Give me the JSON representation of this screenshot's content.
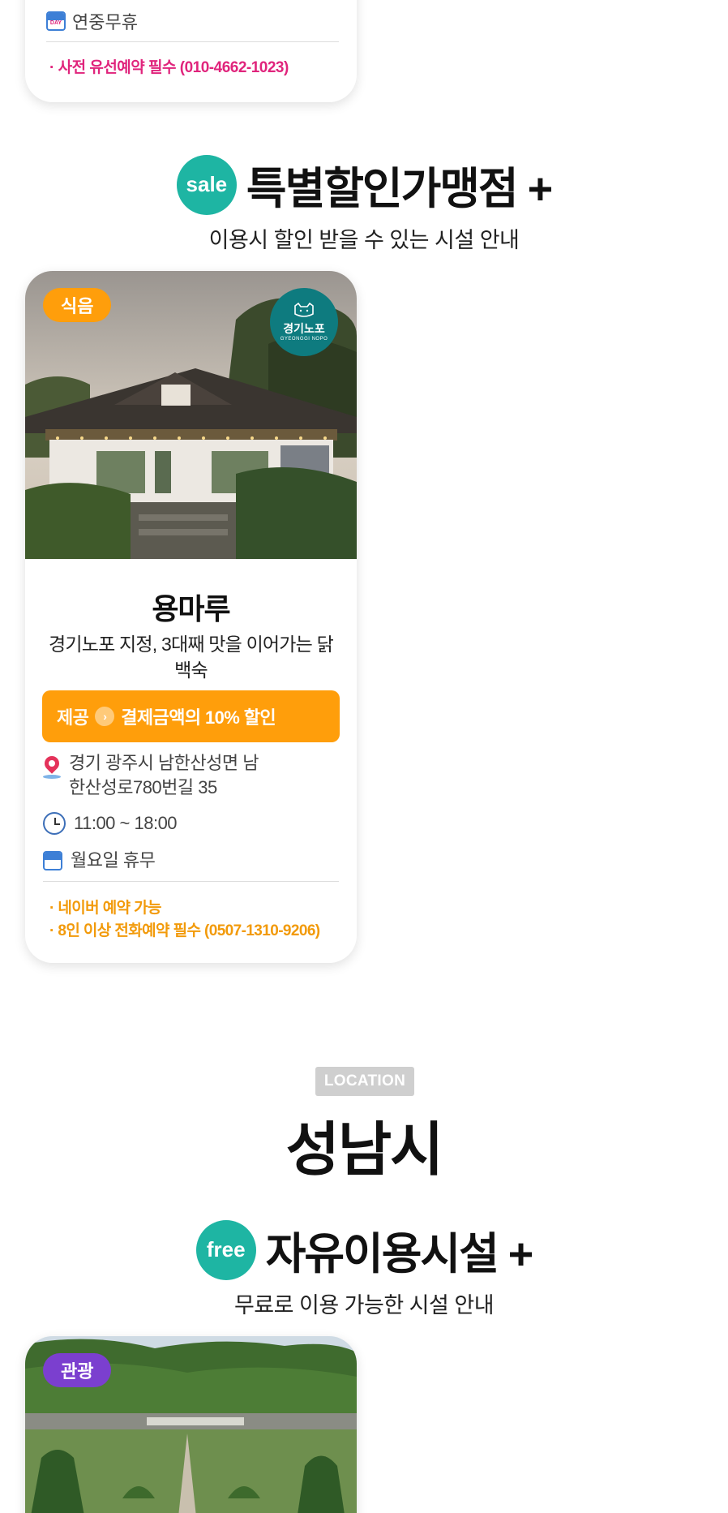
{
  "prev_card": {
    "holiday": "연중무휴",
    "note": "· 사전 유선예약 필수 (010-4662-1023)"
  },
  "sale_section": {
    "badge": "sale",
    "title": "특별할인가맹점 +",
    "subtitle": "이용시 할인 받을 수 있는 시설 안내"
  },
  "sale_card": {
    "category": "식음",
    "category_color": "#ff9e0b",
    "logo": {
      "name": "경기노포",
      "en": "GYEONGGI NOPO"
    },
    "name": "용마루",
    "description": "경기노포 지정, 3대째 맛을 이어가는 닭백숙",
    "offer_label": "제공",
    "offer_text": "결제금액의 10% 할인",
    "address": "경기 광주시 남한산성면 남한산성로780번길 35",
    "hours": "11:00 ~ 18:00",
    "closed": "월요일 휴무",
    "notes": [
      "· 네이버 예약 가능",
      "· 8인 이상 전화예약 필수 (0507-1310-9206)"
    ]
  },
  "location": {
    "tag": "LOCATION",
    "city": "성남시"
  },
  "free_section": {
    "badge": "free",
    "title": "자유이용시설 +",
    "subtitle": "무료로 이용 가능한 시설 안내"
  },
  "free_card": {
    "category": "관광",
    "category_color": "#7b3fcf"
  },
  "colors": {
    "teal": "#1eb5a3",
    "orange": "#ff9e0b",
    "pink_note": "#e0247c",
    "purple": "#7b3fcf"
  }
}
